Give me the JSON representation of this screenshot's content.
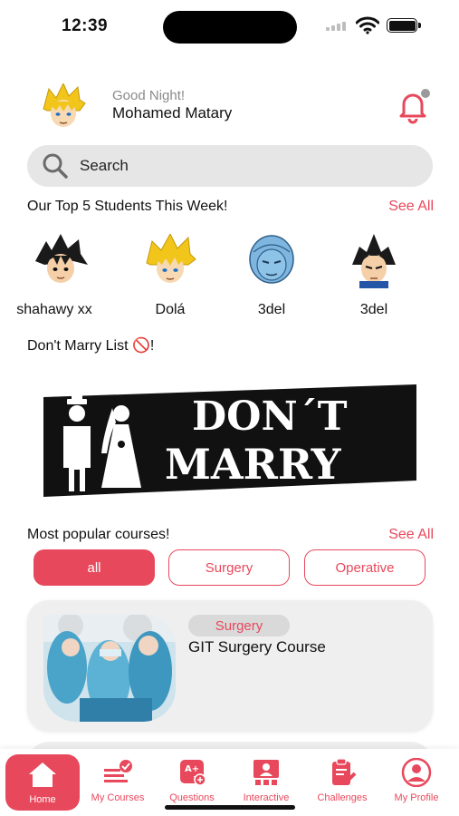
{
  "status_bar": {
    "time": "12:39"
  },
  "header": {
    "greeting": "Good Night!",
    "user_name": "Mohamed Matary"
  },
  "search": {
    "placeholder": "Search"
  },
  "top_students": {
    "title": "Our Top 5 Students This Week!",
    "see_all": "See All",
    "items": [
      {
        "name": "shahawy xx",
        "avatar": "black-spiky-hair-avatar"
      },
      {
        "name": "Dolá",
        "avatar": "blonde-spiky-hair-avatar"
      },
      {
        "name": "3del",
        "avatar": "blue-green-hair-avatar"
      },
      {
        "name": "3del",
        "avatar": "dark-spiky-hair-avatar"
      }
    ]
  },
  "dont_marry": {
    "title": "Don't Marry List 🚫!",
    "banner_line1": "DON´T",
    "banner_line2": "MARRY"
  },
  "popular_courses": {
    "title": "Most popular courses!",
    "see_all": "See All",
    "filters": [
      {
        "label": "all",
        "active": true
      },
      {
        "label": "Surgery",
        "active": false
      },
      {
        "label": "Operative",
        "active": false
      }
    ],
    "courses": [
      {
        "tag": "Surgery",
        "title": "GIT Surgery Course"
      }
    ]
  },
  "bottom_nav": {
    "items": [
      {
        "label": "Home",
        "icon": "home-icon",
        "active": true
      },
      {
        "label": "My Courses",
        "icon": "my-courses-icon",
        "active": false
      },
      {
        "label": "Questions",
        "icon": "questions-icon",
        "active": false
      },
      {
        "label": "Interactive",
        "icon": "interactive-icon",
        "active": false
      },
      {
        "label": "Challenges",
        "icon": "challenges-icon",
        "active": false
      },
      {
        "label": "My Profile",
        "icon": "profile-icon",
        "active": false
      }
    ]
  },
  "colors": {
    "accent": "#e8485c",
    "card": "#efefef",
    "search_bg": "#e6e6e6"
  }
}
